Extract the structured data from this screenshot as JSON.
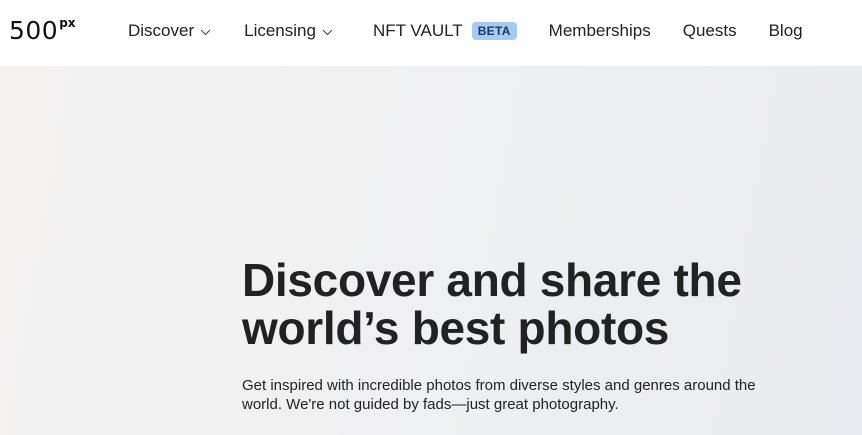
{
  "brand": {
    "logo_main": "500",
    "logo_sup": "px"
  },
  "nav": {
    "items": [
      {
        "label": "Discover",
        "has_dropdown": true
      },
      {
        "label": "Licensing",
        "has_dropdown": true
      },
      {
        "label": "NFT VAULT",
        "badge": "BETA"
      },
      {
        "label": "Memberships"
      },
      {
        "label": "Quests"
      },
      {
        "label": "Blog"
      }
    ]
  },
  "hero": {
    "title_line1": "Discover and share the",
    "title_line2": "world’s best photos",
    "subtitle_line1": "Get inspired with incredible photos from diverse styles and genres around the",
    "subtitle_line2": "world. We're not guided by fads—just great photography."
  },
  "colors": {
    "badge_bg": "#a8c9f0",
    "text": "#222222",
    "hero_bg": "#f1f1f2"
  }
}
